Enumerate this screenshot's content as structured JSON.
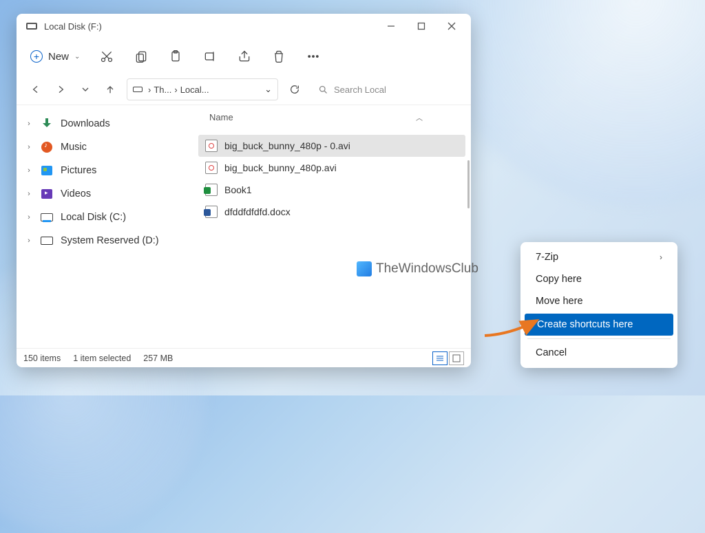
{
  "window": {
    "title": "Local Disk (F:)"
  },
  "toolbar": {
    "new_label": "New"
  },
  "address": {
    "crumb1": "Th...",
    "crumb2": "Local..."
  },
  "search": {
    "placeholder": "Search Local"
  },
  "sidebar": {
    "items": [
      {
        "label": "Downloads"
      },
      {
        "label": "Music"
      },
      {
        "label": "Pictures"
      },
      {
        "label": "Videos"
      },
      {
        "label": "Local Disk (C:)"
      },
      {
        "label": "System Reserved (D:)"
      }
    ]
  },
  "columns": {
    "name": "Name"
  },
  "files": [
    {
      "name": "big_buck_bunny_480p - 0.avi"
    },
    {
      "name": "big_buck_bunny_480p.avi"
    },
    {
      "name": "Book1"
    },
    {
      "name": "dfddfdfdfd.docx"
    }
  ],
  "status": {
    "count": "150 items",
    "selection": "1 item selected",
    "size": "257 MB"
  },
  "contextmenu": {
    "items": [
      "7-Zip",
      "Copy here",
      "Move here",
      "Create shortcuts here",
      "Cancel"
    ]
  },
  "watermark": "TheWindowsClub"
}
